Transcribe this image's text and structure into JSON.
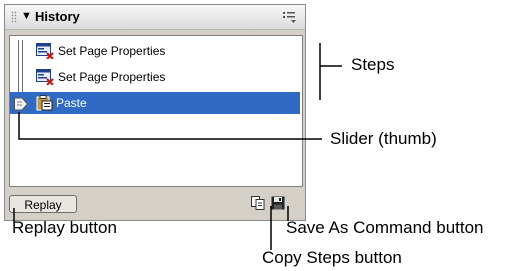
{
  "panel": {
    "title": "History",
    "expander_icon": "triangle-down-icon",
    "options_icon": "panel-options-menu-icon"
  },
  "steps": [
    {
      "label": "Set Page Properties",
      "icon": "page-properties-icon",
      "selected": false
    },
    {
      "label": "Set Page Properties",
      "icon": "page-properties-icon",
      "selected": false
    },
    {
      "label": "Paste",
      "icon": "clipboard-paste-icon",
      "selected": true
    }
  ],
  "bottom": {
    "replay_label": "Replay",
    "copy_icon": "copy-steps-icon",
    "save_icon": "save-floppy-icon"
  },
  "callouts": {
    "steps": "Steps",
    "slider": "Slider (thumb)",
    "replay": "Replay button",
    "save": "Save As Command button",
    "copy": "Copy Steps button"
  },
  "colors": {
    "selection": "#316ac5",
    "panel_bg": "#d4d0c8"
  }
}
